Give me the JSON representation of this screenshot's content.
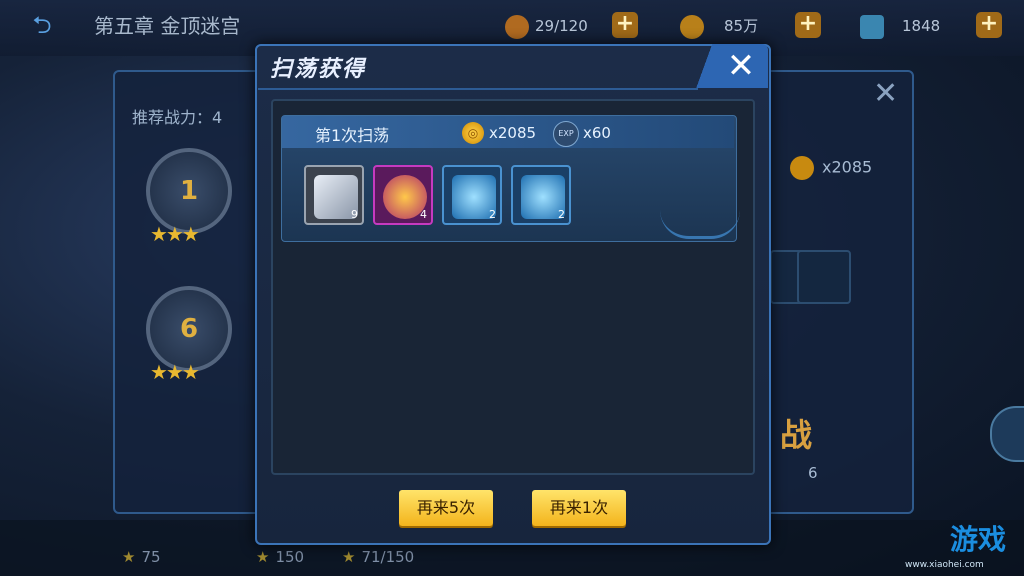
{
  "topbar": {
    "back_icon": "back-arrow-icon",
    "chapter_title": "第五章 金顶迷宫",
    "stamina": "29/120",
    "gold": "85万",
    "diamonds": "1848"
  },
  "background_panel": {
    "recommended_power_label": "推荐战力：4",
    "stages": [
      "1",
      "6"
    ],
    "right_coin_reward": "x2085",
    "battle_label": "战",
    "battle_cost": "6",
    "bottom_stats": [
      "75",
      "150",
      "71/150"
    ]
  },
  "dialog": {
    "title": "扫荡获得",
    "close_icon": "close-icon",
    "sweep": {
      "label": "第1次扫荡",
      "coin_icon": "gold-coin-icon",
      "coin_amount": "x2085",
      "exp_icon": "exp-icon",
      "exp_icon_text": "EXP",
      "exp_amount": "x60"
    },
    "items": [
      {
        "name": "exp-card-icon",
        "count": "9",
        "rarity": "white"
      },
      {
        "name": "purple-orb-icon",
        "count": "4",
        "rarity": "purple"
      },
      {
        "name": "blue-axe-shard-icon",
        "count": "2",
        "rarity": "blue"
      },
      {
        "name": "blue-crest-shard-icon",
        "count": "2",
        "rarity": "blue"
      }
    ],
    "buttons": {
      "sweep5": "再来5次",
      "sweep1": "再来1次"
    }
  },
  "watermark": {
    "text": "游戏",
    "url": "www.xiaohei.com"
  }
}
